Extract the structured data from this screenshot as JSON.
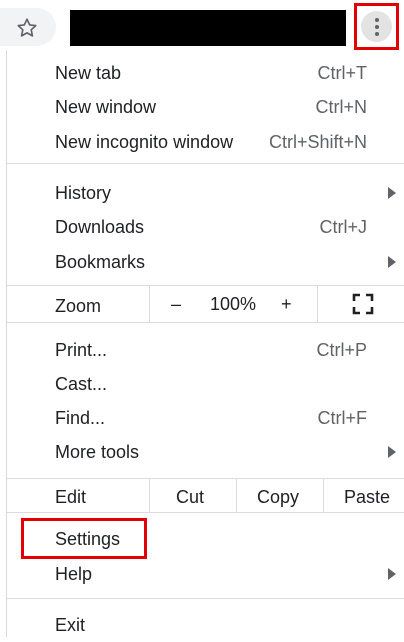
{
  "toolbar": {
    "bookmark_icon": "star-icon",
    "menu_icon": "kebab-menu-icon"
  },
  "menu": {
    "group1": [
      {
        "label": "New tab",
        "shortcut": "Ctrl+T"
      },
      {
        "label": "New window",
        "shortcut": "Ctrl+N"
      },
      {
        "label": "New incognito window",
        "shortcut": "Ctrl+Shift+N"
      }
    ],
    "group2": [
      {
        "label": "History",
        "submenu": true
      },
      {
        "label": "Downloads",
        "shortcut": "Ctrl+J"
      },
      {
        "label": "Bookmarks",
        "submenu": true
      }
    ],
    "zoom": {
      "label": "Zoom",
      "minus": "–",
      "value": "100%",
      "plus": "+",
      "fullscreen_icon": "fullscreen-icon"
    },
    "group3": [
      {
        "label": "Print...",
        "shortcut": "Ctrl+P"
      },
      {
        "label": "Cast..."
      },
      {
        "label": "Find...",
        "shortcut": "Ctrl+F"
      },
      {
        "label": "More tools",
        "submenu": true
      }
    ],
    "edit": {
      "label": "Edit",
      "cut": "Cut",
      "copy": "Copy",
      "paste": "Paste"
    },
    "group4": [
      {
        "label": "Settings"
      },
      {
        "label": "Help",
        "submenu": true
      }
    ],
    "exit": {
      "label": "Exit"
    }
  },
  "colors": {
    "highlight": "#e30000",
    "text": "#202124",
    "secondary_text": "#5f6368",
    "separator": "#dadce0"
  }
}
